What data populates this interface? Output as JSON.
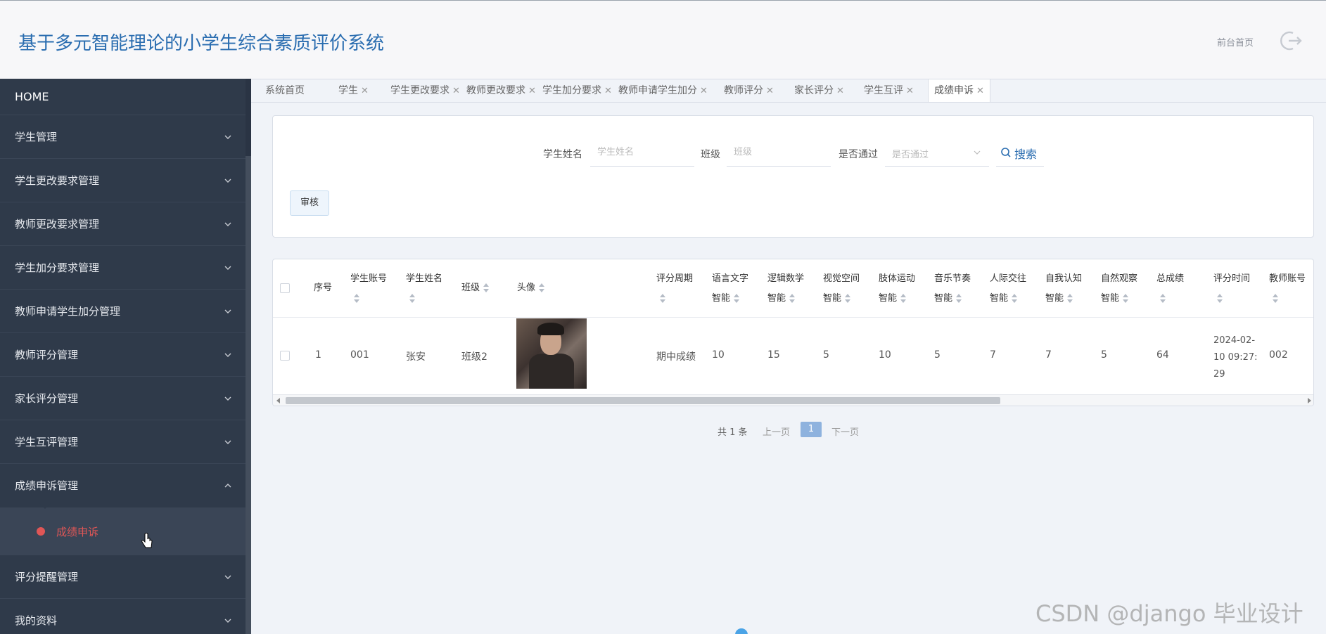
{
  "header": {
    "title": "基于多元智能理论的小学生综合素质评价系统",
    "front_home": "前台首页"
  },
  "sidebar": {
    "home": "HOME",
    "items": [
      {
        "label": "学生管理"
      },
      {
        "label": "学生更改要求管理"
      },
      {
        "label": "教师更改要求管理"
      },
      {
        "label": "学生加分要求管理"
      },
      {
        "label": "教师申请学生加分管理"
      },
      {
        "label": "教师评分管理"
      },
      {
        "label": "家长评分管理"
      },
      {
        "label": "学生互评管理"
      },
      {
        "label": "成绩申诉管理"
      }
    ],
    "sub_item": "成绩申诉",
    "items_after": [
      {
        "label": "评分提醒管理"
      },
      {
        "label": "我的资料"
      }
    ]
  },
  "tabs": [
    {
      "label": "系统首页"
    },
    {
      "label": "学生"
    },
    {
      "label": "学生更改要求"
    },
    {
      "label": "教师更改要求"
    },
    {
      "label": "学生加分要求"
    },
    {
      "label": "教师申请学生加分"
    },
    {
      "label": "教师评分"
    },
    {
      "label": "家长评分"
    },
    {
      "label": "学生互评"
    },
    {
      "label": "成绩申诉"
    }
  ],
  "search": {
    "student_name_label": "学生姓名",
    "student_name_placeholder": "学生姓名",
    "class_label": "班级",
    "class_placeholder": "班级",
    "passed_label": "是否通过",
    "passed_placeholder": "是否通过",
    "search_button": "搜索",
    "audit_button": "审核"
  },
  "table": {
    "headers": {
      "index": "序号",
      "account": "学生账号",
      "name": "学生姓名",
      "class": "班级",
      "avatar": "头像",
      "period": "评分周期",
      "lang1": "语言文字",
      "lang2": "智能",
      "logic1": "逻辑数学",
      "logic2": "智能",
      "visual1": "视觉空间",
      "visual2": "智能",
      "body1": "肢体运动",
      "body2": "智能",
      "music1": "音乐节奏",
      "music2": "智能",
      "inter1": "人际交往",
      "inter2": "智能",
      "intra1": "自我认知",
      "intra2": "智能",
      "nature1": "自然观察",
      "nature2": "智能",
      "total": "总成绩",
      "time": "评分时间",
      "teacher": "教师账号"
    },
    "row": {
      "index": "1",
      "account": "001",
      "name": "张安",
      "class": "班级2",
      "period": "期中成绩",
      "lang": "10",
      "logic": "15",
      "visual": "5",
      "body": "10",
      "music": "5",
      "inter": "7",
      "intra": "7",
      "nature": "5",
      "total": "64",
      "time1": "2024-02-",
      "time2": "10 09:27:",
      "time3": "29",
      "teacher": "002"
    }
  },
  "pagination": {
    "total": "共 1 条",
    "prev": "上一页",
    "current": "1",
    "next": "下一页"
  },
  "watermark": "CSDN @django 毕业设计",
  "colors": {
    "sidebar_bg": "#2f3a4a",
    "accent": "#2a6db0",
    "active_menu": "#e05656",
    "page_bg": "#f0f3f8"
  }
}
